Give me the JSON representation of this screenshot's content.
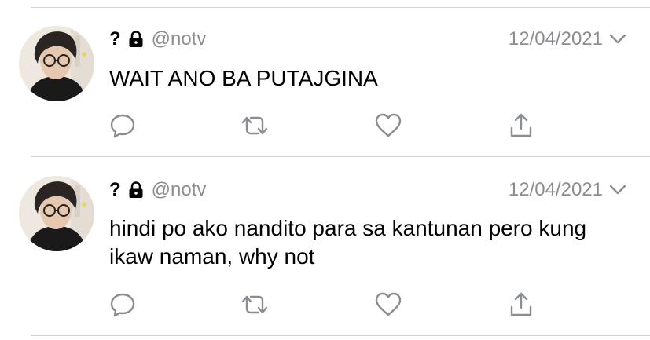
{
  "tweets": [
    {
      "display_name": "?",
      "handle": "@notv",
      "date": "12/04/2021",
      "text": "WAIT ANO BA PUTAJGINA"
    },
    {
      "display_name": "?",
      "handle": "@notv",
      "date": "12/04/2021",
      "text": "hindi po ako nandito para sa kantunan pero kung ikaw naman, why not"
    }
  ],
  "icons": {
    "lock": "lock-icon",
    "chevron": "chevron-down-icon",
    "reply": "reply-icon",
    "retweet": "retweet-icon",
    "like": "heart-icon",
    "share": "share-icon"
  },
  "colors": {
    "text": "#000000",
    "secondary_text": "#8a8d91",
    "icon": "#8a8d91",
    "divider": "#cfd3d6"
  }
}
